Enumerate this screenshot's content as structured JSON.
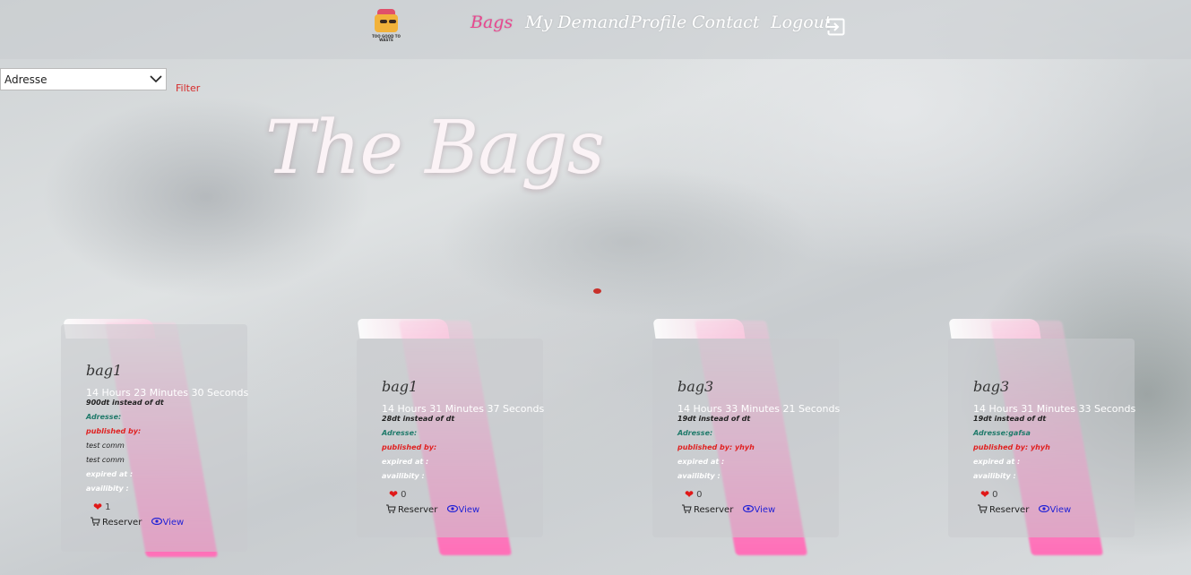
{
  "navbar": {
    "logo_text": "TOO GOOD TO WASTE",
    "links": [
      {
        "label": "Bags",
        "active": true
      },
      {
        "label": "My Demand",
        "active": false
      },
      {
        "label": "Profile",
        "active": false
      },
      {
        "label": "Contact",
        "active": false
      }
    ],
    "logout_label": "Logout"
  },
  "filter": {
    "select_value": "Adresse",
    "button_label": "Filter"
  },
  "hero": {
    "title": "The Bags"
  },
  "colors": {
    "accent": "#e8478f",
    "address": "#1f7a6a",
    "published": "#e02020",
    "link": "#2323d6"
  },
  "cards": [
    {
      "name": "bag1",
      "countdown": "14 Hours 23 Minutes 30 Seconds",
      "price": "900dt instead of dt",
      "address": "Adresse:",
      "published_by": "published by:",
      "comments": [
        "test comm",
        "test comm"
      ],
      "expired_at": "expired at :",
      "availability": "availibity :",
      "likes": "1",
      "reserve_label": "Reserver",
      "view_label": "View"
    },
    {
      "name": "bag1",
      "countdown": "14 Hours 31 Minutes 37 Seconds",
      "price": "28dt instead of dt",
      "address": "Adresse:",
      "published_by": "published by:",
      "comments": [],
      "expired_at": "expired at :",
      "availability": "availibity :",
      "likes": "0",
      "reserve_label": "Reserver",
      "view_label": "View"
    },
    {
      "name": "bag3",
      "countdown": "14 Hours 33 Minutes 21 Seconds",
      "price": "19dt instead of dt",
      "address": "Adresse:",
      "published_by": "published by: yhyh",
      "comments": [],
      "expired_at": "expired at :",
      "availability": "availibity :",
      "likes": "0",
      "reserve_label": "Reserver",
      "view_label": "View"
    },
    {
      "name": "bag3",
      "countdown": "14 Hours 31 Minutes 33 Seconds",
      "price": "19dt instead of dt",
      "address": "Adresse:gafsa",
      "published_by": "published by: yhyh",
      "comments": [],
      "expired_at": "expired at :",
      "availability": "availibity :",
      "likes": "0",
      "reserve_label": "Reserver",
      "view_label": "View"
    }
  ]
}
